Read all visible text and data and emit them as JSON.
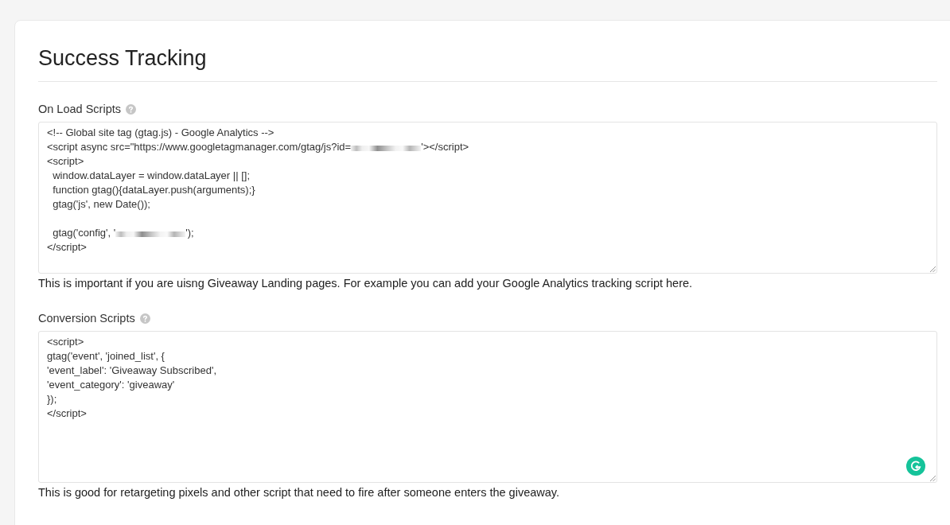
{
  "page": {
    "title": "Success Tracking"
  },
  "fields": [
    {
      "label": "On Load Scripts",
      "help_icon": true,
      "writing_assistant_badge": false,
      "lines": [
        {
          "kind": "code",
          "segments": [
            {
              "kind": "text",
              "text": "<!-- Global site tag (gtag.js) - Google Analytics -->"
            }
          ]
        },
        {
          "kind": "code",
          "segments": [
            {
              "kind": "text",
              "text": "<script async src=\"https://www.googletagmanager.com/gtag/js?id="
            },
            {
              "kind": "redacted"
            },
            {
              "kind": "text",
              "text": "'></script>"
            }
          ]
        },
        {
          "kind": "code",
          "segments": [
            {
              "kind": "text",
              "text": "<script>"
            }
          ]
        },
        {
          "kind": "code",
          "segments": [
            {
              "kind": "text",
              "text": "  window.dataLayer = window.dataLayer || [];"
            }
          ]
        },
        {
          "kind": "code",
          "segments": [
            {
              "kind": "text",
              "text": "  function gtag(){dataLayer.push(arguments);}"
            }
          ]
        },
        {
          "kind": "code",
          "segments": [
            {
              "kind": "text",
              "text": "  gtag('js', new Date());"
            }
          ]
        },
        {
          "kind": "blank"
        },
        {
          "kind": "code",
          "segments": [
            {
              "kind": "text",
              "text": "  gtag('config', '"
            },
            {
              "kind": "redacted"
            },
            {
              "kind": "text",
              "text": "');"
            }
          ]
        },
        {
          "kind": "code",
          "segments": [
            {
              "kind": "text",
              "text": "</script>"
            }
          ]
        }
      ],
      "hint": "This is important if you are uisng Giveaway Landing pages. For example you can add your Google Analytics tracking script here."
    },
    {
      "label": "Conversion Scripts",
      "help_icon": true,
      "writing_assistant_badge": true,
      "lines": [
        {
          "kind": "code",
          "segments": [
            {
              "kind": "text",
              "text": "<script>"
            }
          ]
        },
        {
          "kind": "code",
          "segments": [
            {
              "kind": "text",
              "text": "gtag('event', 'joined_list', {"
            }
          ]
        },
        {
          "kind": "code",
          "segments": [
            {
              "kind": "text",
              "text": "'event_label': 'Giveaway Subscribed',"
            }
          ]
        },
        {
          "kind": "code",
          "segments": [
            {
              "kind": "text",
              "text": "'event_category': 'giveaway'"
            }
          ]
        },
        {
          "kind": "code",
          "segments": [
            {
              "kind": "text",
              "text": "});"
            }
          ]
        },
        {
          "kind": "code",
          "segments": [
            {
              "kind": "text",
              "text": "</script>"
            }
          ]
        }
      ],
      "hint": "This is good for retargeting pixels and other script that need to fire after someone enters the giveaway."
    }
  ]
}
